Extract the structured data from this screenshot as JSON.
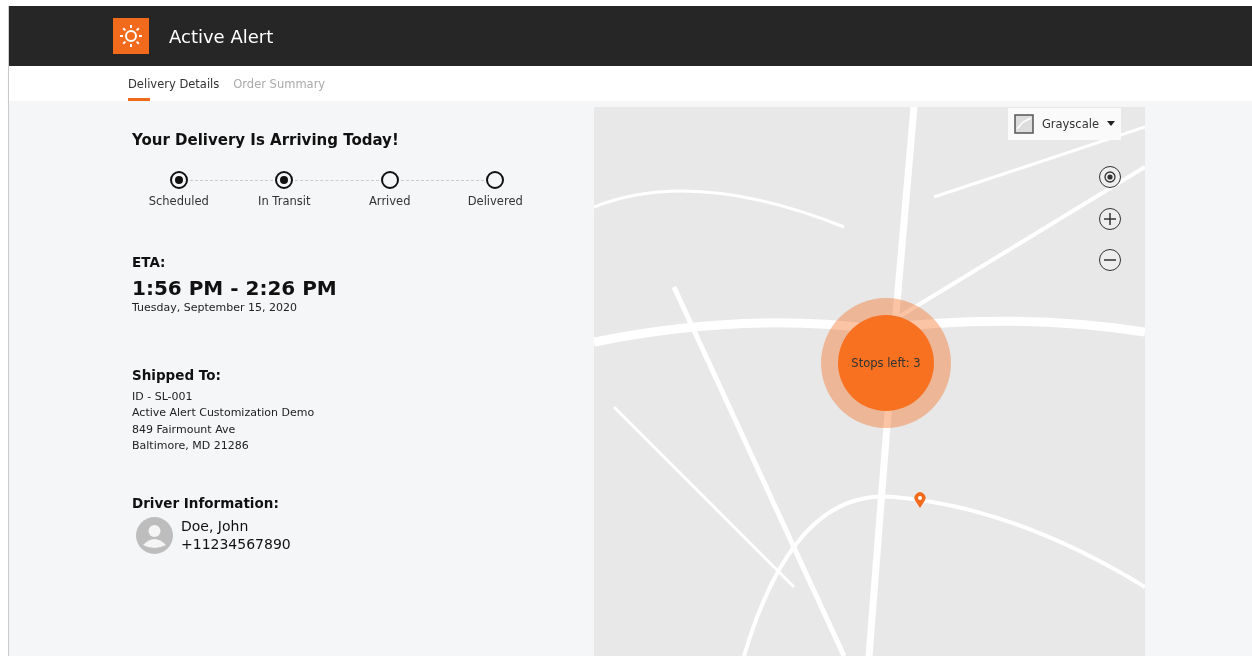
{
  "header": {
    "title": "Active Alert"
  },
  "tabs": [
    {
      "label": "Delivery Details",
      "selected": true
    },
    {
      "label": "Order Summary",
      "selected": false
    }
  ],
  "heading": "Your Delivery Is Arriving Today!",
  "steps": [
    {
      "label": "Scheduled",
      "reached": true
    },
    {
      "label": "In Transit",
      "reached": true
    },
    {
      "label": "Arrived",
      "reached": false
    },
    {
      "label": "Delivered",
      "reached": false
    }
  ],
  "eta": {
    "label": "ETA:",
    "time": "1:56 PM - 2:26 PM",
    "date": "Tuesday, September 15, 2020"
  },
  "shipped_to": {
    "label": "Shipped To:",
    "lines": [
      "ID - SL-001",
      "Active Alert Customization Demo",
      "849 Fairmount Ave",
      "Baltimore, MD 21286"
    ]
  },
  "driver": {
    "label": "Driver Information:",
    "name": "Doe, John",
    "phone": "+11234567890"
  },
  "map": {
    "style_selector": "Grayscale",
    "stops_label": "Stops left: 3"
  }
}
